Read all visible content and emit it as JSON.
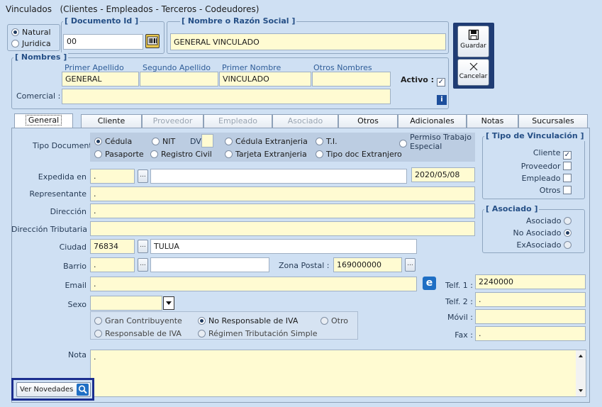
{
  "window_title": "Vinculados",
  "window_subtitle": "(Clientes - Empleados - Terceros - Codeudores)",
  "person_type": {
    "natural": "Natural",
    "juridica": "Juridica",
    "selected": "natural"
  },
  "documento": {
    "legend": "[ Documento Id ]",
    "value": "00"
  },
  "razon_social": {
    "legend": "[ Nombre o Razón Social ]",
    "value": "GENERAL VINCULADO"
  },
  "nombres": {
    "legend": "[ Nombres ]",
    "primer_apellido_label": "Primer Apellido",
    "primer_apellido": "GENERAL",
    "segundo_apellido_label": "Segundo Apellido",
    "segundo_apellido": "",
    "primer_nombre_label": "Primer Nombre",
    "primer_nombre": "VINCULADO",
    "otros_nombres_label": "Otros Nombres",
    "otros_nombres": "",
    "comercial_label": "Comercial :",
    "comercial": "",
    "activo_label": "Activo :",
    "activo_checked": "✓"
  },
  "actions": {
    "guardar": "Guardar",
    "cancelar": "Cancelar"
  },
  "tabs": [
    "General",
    "Cliente",
    "Proveedor",
    "Empleado",
    "Asociado",
    "Otros",
    "Adicionales",
    "Notas",
    "Sucursales"
  ],
  "tipo_documento": {
    "label": "Tipo Documento",
    "options": [
      "Cédula",
      "NIT",
      "Cédula Extranjeria",
      "T.I.",
      "Permiso Trabajo",
      "Especial",
      "Pasaporte",
      "Registro Civil",
      "Tarjeta Extranjeria",
      "Tipo doc Extranjero"
    ],
    "dv_label": "DV",
    "selected": "Cédula"
  },
  "form": {
    "expedida_label": "Expedida en",
    "expedida_code": ".",
    "expedida_name": "",
    "fecha": "2020/05/08",
    "representante_label": "Representante",
    "representante": ".",
    "direccion_label": "Dirección",
    "direccion": ".",
    "dir_tributaria_label": "Dirección Tributaria",
    "dir_tributaria": "",
    "ciudad_label": "Ciudad",
    "ciudad_code": "76834",
    "ciudad_name": "TULUA",
    "barrio_label": "Barrio",
    "barrio_code": ".",
    "barrio_name": "",
    "zona_postal_label": "Zona Postal :",
    "zona_postal": "169000000",
    "email_label": "Email",
    "email": ".",
    "sexo_label": "Sexo",
    "sexo": "",
    "nota_label": "Nota",
    "nota": "."
  },
  "tributario": {
    "options": [
      "Gran Contribuyente",
      "No Responsable de IVA",
      "Otro",
      "Responsable de IVA",
      "Régimen Tributación Simple"
    ],
    "selected": "No Responsable de IVA"
  },
  "telefonos": {
    "telf1_label": "Telf. 1 :",
    "telf1": "2240000",
    "telf2_label": "Telf. 2 :",
    "telf2": ".",
    "movil_label": "Móvil :",
    "movil": "",
    "fax_label": "Fax :",
    "fax": "."
  },
  "tipo_vinculacion": {
    "legend": "[ Tipo de Vinculación ]",
    "cliente": "Cliente",
    "cliente_mark": "✓",
    "proveedor": "Proveedor",
    "empleado": "Empleado",
    "otros": "Otros"
  },
  "asociado": {
    "legend": "[ Asociado ]",
    "options": [
      "Asociado",
      "No Asociado",
      "ExAsociado"
    ],
    "selected": "No Asociado"
  },
  "ver_novedades": "Ver Novedades",
  "colors": {
    "background": "#cfe0f3",
    "field": "#fffbd2",
    "legend": "#254f86",
    "highlight": "#1b2e8f"
  }
}
